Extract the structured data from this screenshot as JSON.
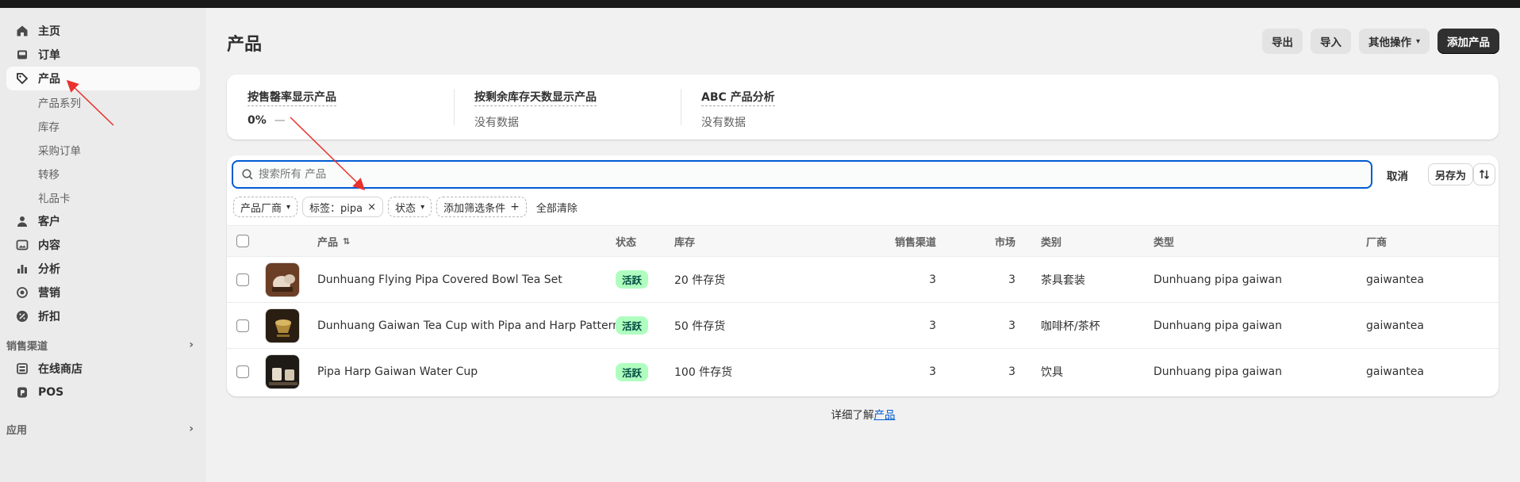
{
  "sidebar": {
    "items": [
      {
        "label": "主页",
        "icon": "home-icon"
      },
      {
        "label": "订单",
        "icon": "inbox-icon"
      },
      {
        "label": "产品",
        "icon": "tag-icon",
        "active": true
      }
    ],
    "sub_items": [
      "产品系列",
      "库存",
      "采购订单",
      "转移",
      "礼品卡"
    ],
    "items2": [
      {
        "label": "客户",
        "icon": "person-icon"
      },
      {
        "label": "内容",
        "icon": "image-icon"
      },
      {
        "label": "分析",
        "icon": "chart-icon"
      },
      {
        "label": "营销",
        "icon": "target-icon"
      },
      {
        "label": "折扣",
        "icon": "discount-icon"
      }
    ],
    "sales_channels_label": "销售渠道",
    "channels": [
      {
        "label": "在线商店",
        "icon": "store-icon"
      },
      {
        "label": "POS",
        "icon": "pos-icon"
      }
    ],
    "apps_label": "应用"
  },
  "header": {
    "title": "产品",
    "export_label": "导出",
    "import_label": "导入",
    "more_actions_label": "其他操作",
    "add_product_label": "添加产品"
  },
  "metrics": [
    {
      "title": "按售罄率显示产品",
      "value": "0%",
      "extra": "—"
    },
    {
      "title": "按剩余库存天数显示产品",
      "value": "没有数据"
    },
    {
      "title": "ABC 产品分析",
      "value": "没有数据"
    }
  ],
  "search": {
    "placeholder": "搜索所有 产品",
    "cancel_label": "取消",
    "save_as_label": "另存为"
  },
  "filters": {
    "vendor_label": "产品厂商",
    "tag_label": "标签：pipa",
    "status_label": "状态",
    "add_filter_label": "添加筛选条件",
    "clear_all_label": "全部清除"
  },
  "table": {
    "headers": {
      "product": "产品",
      "status": "状态",
      "inventory": "库存",
      "channels": "销售渠道",
      "markets": "市场",
      "category": "类别",
      "type": "类型",
      "vendor": "厂商"
    },
    "rows": [
      {
        "name": "Dunhuang Flying Pipa Covered Bowl Tea Set",
        "status": "活跃",
        "inventory": "20 件存货",
        "channels": "3",
        "markets": "3",
        "category": "茶具套装",
        "type": "Dunhuang pipa gaiwan",
        "vendor": "gaiwantea"
      },
      {
        "name": "Dunhuang Gaiwan Tea Cup with Pipa and Harp Pattern",
        "status": "活跃",
        "inventory": "50 件存货",
        "channels": "3",
        "markets": "3",
        "category": "咖啡杯/茶杯",
        "type": "Dunhuang pipa gaiwan",
        "vendor": "gaiwantea"
      },
      {
        "name": "Pipa Harp Gaiwan Water Cup",
        "status": "活跃",
        "inventory": "100 件存货",
        "channels": "3",
        "markets": "3",
        "category": "饮具",
        "type": "Dunhuang pipa gaiwan",
        "vendor": "gaiwantea"
      }
    ]
  },
  "footer": {
    "prefix": "详细了解",
    "link": "产品"
  },
  "colors": {
    "accent": "#005bd3",
    "badge_bg": "#affebf",
    "annotation_arrow": "#e8322d"
  }
}
